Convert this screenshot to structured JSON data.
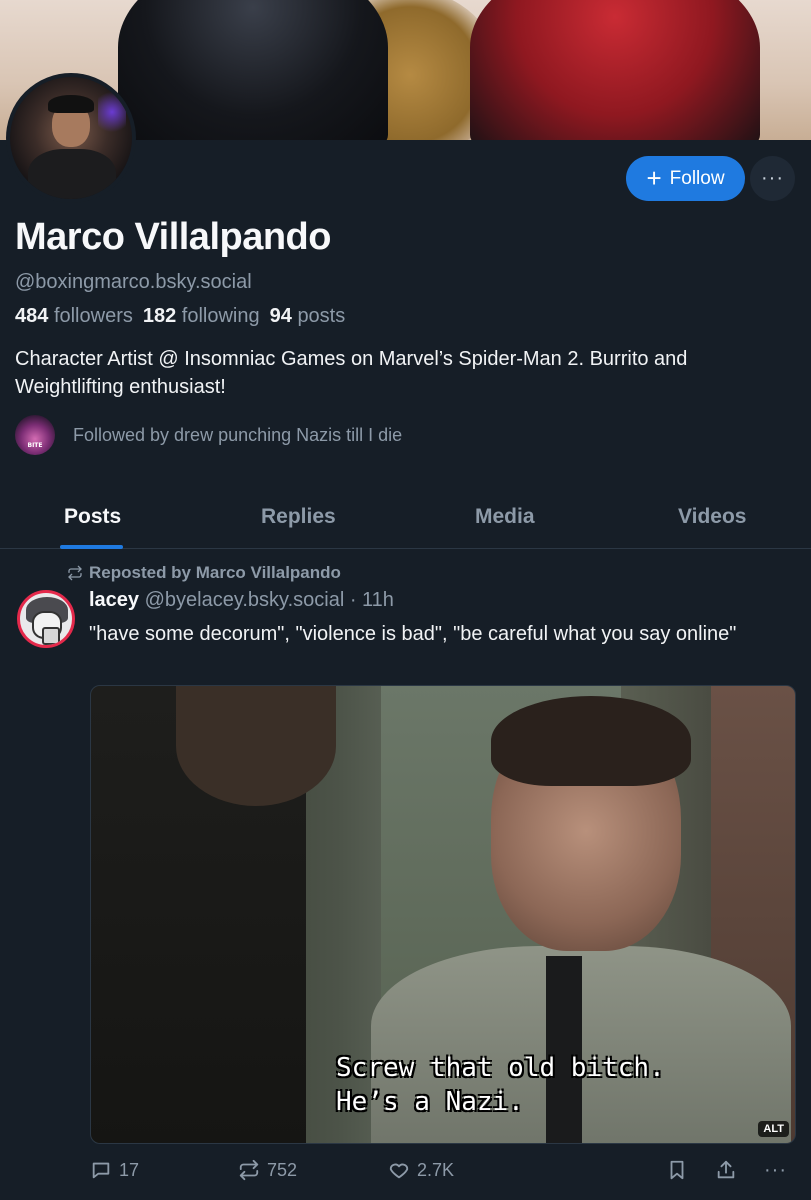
{
  "profile": {
    "display_name": "Marco Villalpando",
    "handle": "@boxingmarco.bsky.social",
    "followers_count": "484",
    "followers_label": "followers",
    "following_count": "182",
    "following_label": "following",
    "posts_count": "94",
    "posts_label": "posts",
    "bio": "Character Artist @ Insomniac Games on Marvel’s Spider-Man 2. Burrito and Weightlifting enthusiast!",
    "followed_by": "Followed by drew punching Nazis till I die",
    "follow_button": "Follow",
    "more_button": "···",
    "follow_icon": "plus-icon"
  },
  "tabs": [
    {
      "label": "Posts",
      "active": true
    },
    {
      "label": "Replies",
      "active": false
    },
    {
      "label": "Media",
      "active": false
    },
    {
      "label": "Videos",
      "active": false
    }
  ],
  "post": {
    "repost_label": "Reposted by Marco Villalpando",
    "author_name": "lacey",
    "author_handle": "@byelacey.bsky.social",
    "time": "· 11h",
    "text": "\"have some decorum\", \"violence is bad\", \"be careful what you say online\"",
    "image_caption": "Screw that old bitch.\nHe’s a Nazi.",
    "alt_badge": "ALT",
    "reply_count": "17",
    "repost_count": "752",
    "like_count": "2.7K"
  },
  "colors": {
    "background": "#161e27",
    "accent": "#1f7ae0",
    "muted_text": "#8d9aa8"
  }
}
